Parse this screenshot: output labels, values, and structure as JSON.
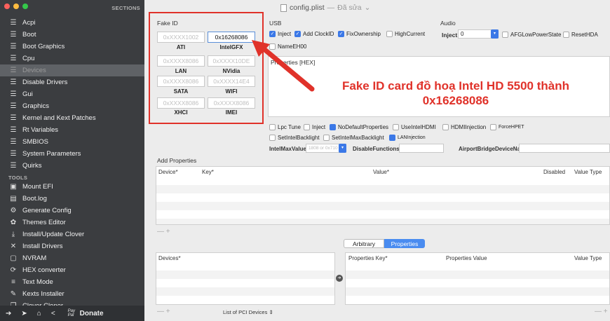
{
  "sidebar": {
    "sections_header": "SECTIONS",
    "items": [
      {
        "label": "Acpi",
        "icon": "list-icon"
      },
      {
        "label": "Boot",
        "icon": "list-icon"
      },
      {
        "label": "Boot Graphics",
        "icon": "list-icon"
      },
      {
        "label": "Cpu",
        "icon": "list-icon"
      },
      {
        "label": "Devices",
        "icon": "list-icon",
        "selected": true
      },
      {
        "label": "Disable Drivers",
        "icon": "list-icon"
      },
      {
        "label": "Gui",
        "icon": "list-icon"
      },
      {
        "label": "Graphics",
        "icon": "list-icon"
      },
      {
        "label": "Kernel and Kext Patches",
        "icon": "list-icon"
      },
      {
        "label": "Rt Variables",
        "icon": "list-icon"
      },
      {
        "label": "SMBIOS",
        "icon": "list-icon"
      },
      {
        "label": "System Parameters",
        "icon": "list-icon"
      },
      {
        "label": "Quirks",
        "icon": "list-icon"
      }
    ],
    "tools_header": "TOOLS",
    "tools": [
      {
        "label": "Mount EFI",
        "icon": "disk-icon"
      },
      {
        "label": "Boot.log",
        "icon": "log-icon"
      },
      {
        "label": "Generate Config",
        "icon": "gears-icon"
      },
      {
        "label": "Themes Editor",
        "icon": "palette-icon"
      },
      {
        "label": "Install/Update Clover",
        "icon": "download-icon"
      },
      {
        "label": "Install Drivers",
        "icon": "tools-icon"
      },
      {
        "label": "NVRAM",
        "icon": "chip-icon"
      },
      {
        "label": "HEX converter",
        "icon": "convert-icon"
      },
      {
        "label": "Text Mode",
        "icon": "text-icon"
      },
      {
        "label": "Kexts Installer",
        "icon": "kext-icon"
      },
      {
        "label": "Clover Cloner",
        "icon": "clone-icon"
      }
    ],
    "bottom": {
      "donate_label": "Donate",
      "paypal": "Pay Pal"
    }
  },
  "titlebar": {
    "filename": "config.plist",
    "separator": "—",
    "status": "Đã sửa"
  },
  "fake_id": {
    "title": "Fake ID",
    "fields": [
      {
        "value": "0xXXXX1002",
        "label": "ATI",
        "filled": false
      },
      {
        "value": "0x16268086",
        "label": "IntelGFX",
        "filled": true
      },
      {
        "value": "0xXXXX8086",
        "label": "LAN",
        "filled": false
      },
      {
        "value": "0xXXXX10DE",
        "label": "NVidia",
        "filled": false
      },
      {
        "value": "0xXXXX8086",
        "label": "SATA",
        "filled": false
      },
      {
        "value": "0xXXXX14E4",
        "label": "WIFI",
        "filled": false
      },
      {
        "value": "0xXXXX8086",
        "label": "XHCI",
        "filled": false
      },
      {
        "value": "0xXXXX8086",
        "label": "IMEI",
        "filled": false
      }
    ]
  },
  "usb": {
    "title": "USB",
    "inject": "Inject",
    "add_clockid": "Add ClockID",
    "fixownership": "FixOwnership",
    "highcurrent": "HighCurrent",
    "nameeh00": "NameEH00"
  },
  "audio": {
    "title": "Audio",
    "inject_label": "Inject",
    "inject_value": "0",
    "afg": "AFGLowPowerState",
    "reset": "ResetHDA"
  },
  "properties": {
    "title": "Properties [HEX]"
  },
  "intel": {
    "lpc_tune": "Lpc Tune",
    "inject": "Inject",
    "no_default": "NoDefaultProperties",
    "use_hdmi": "UseIntelHDMI",
    "hdmi_injection": "HDMIInjection",
    "force_hpet": "ForceHPET",
    "set_backlight": "SetIntelBacklight",
    "set_max_backlight": "SetIntelMaxBacklight",
    "lan_injection": "LANInjection",
    "max_value_label": "IntelMaxValue",
    "max_value_placeholder": "1808 or 0x710",
    "disable_functions": "DisableFunctions",
    "airport": "AirportBridgeDeviceName"
  },
  "add_properties": {
    "title": "Add Properties",
    "columns": [
      "Device*",
      "Key*",
      "Value*",
      "Disabled",
      "Value Type"
    ],
    "controls": "— +"
  },
  "segmented": {
    "arbitrary": "Arbitrary",
    "properties": "Properties"
  },
  "lower": {
    "devices_col": "Devices*",
    "props_cols": [
      "Properties Key*",
      "Properties Value",
      "Value Type"
    ],
    "controls": "— +",
    "pci_list": "List of PCI Devices",
    "right_controls": "— +"
  },
  "annotation": {
    "line1": "Fake ID card đồ hoạ Intel HD 5500 thành",
    "line2": "0x16268086"
  },
  "colors": {
    "accent": "#3b78e7",
    "annotation": "#e0322a",
    "sidebar": "#3b3d40"
  }
}
